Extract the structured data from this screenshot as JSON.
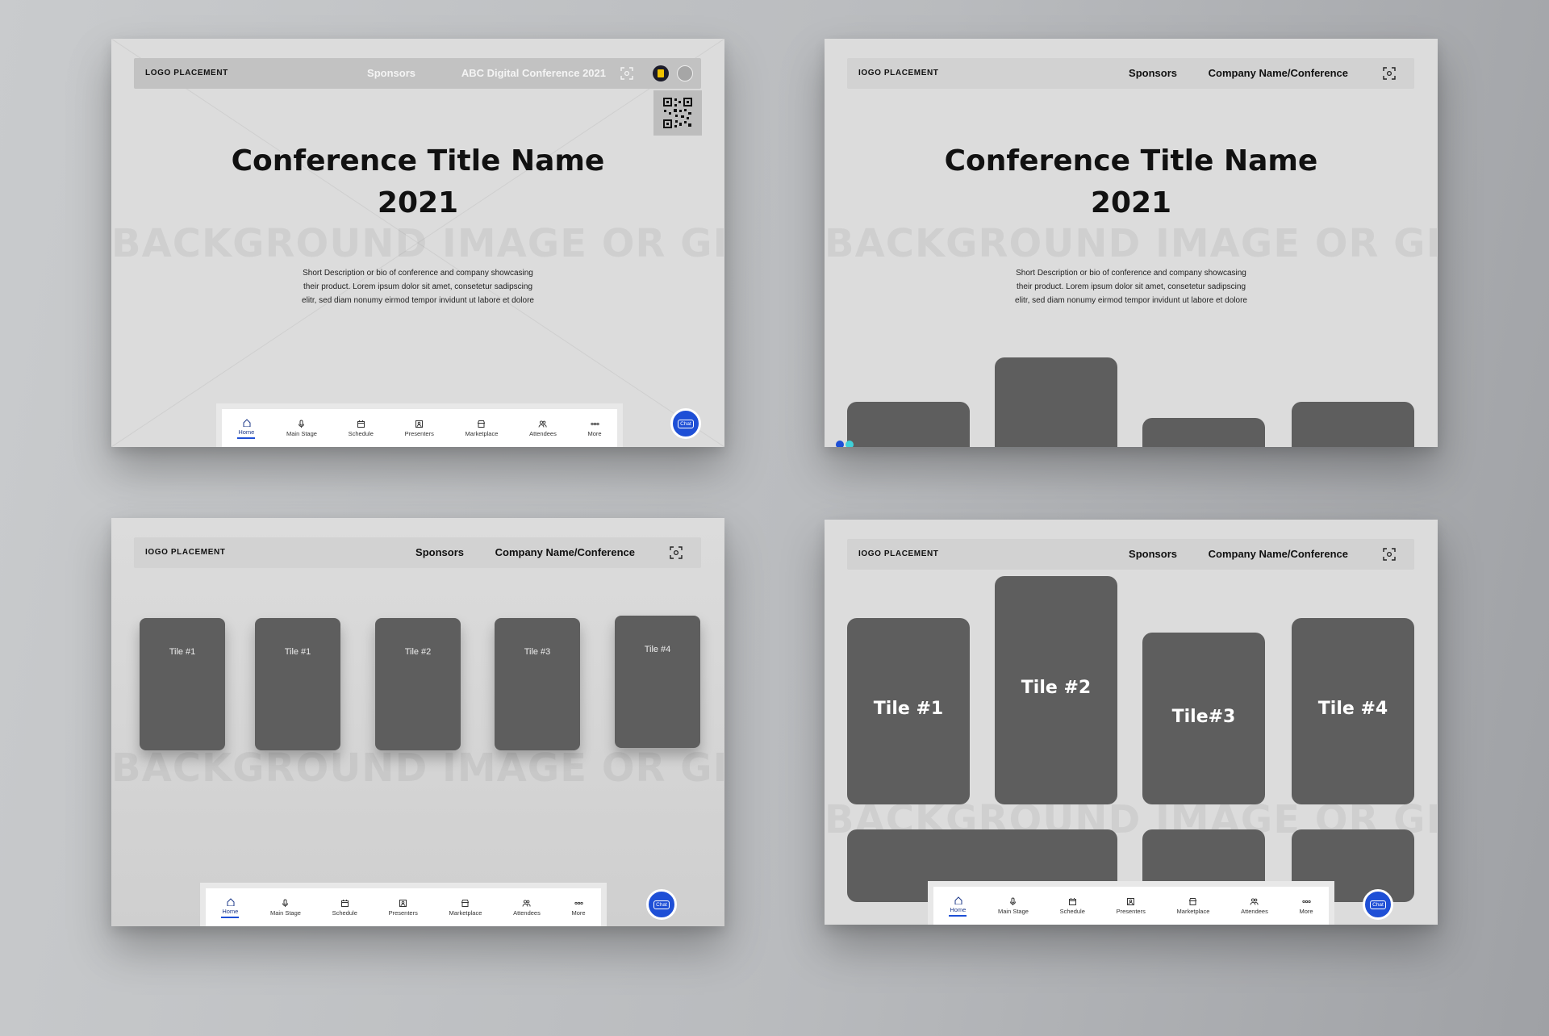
{
  "panels": [
    {
      "header": {
        "logo": "LOGO PLACEMENT",
        "sponsors": "Sponsors",
        "company": "ABC Digital Conference 2021"
      },
      "hero": {
        "title_line1": "Conference Title Name",
        "title_line2": "2021",
        "bg_label": "BACKGROUND IMAGE OR GIF",
        "desc_line1": "Short Description or bio of conference and company showcasing",
        "desc_line2": "their product. Lorem ipsum dolor sit amet, consetetur sadipscing",
        "desc_line3": "elitr, sed diam nonumy eirmod tempor invidunt ut labore et dolore"
      }
    },
    {
      "header": {
        "logo": "IOGO PLACEMENT",
        "sponsors": "Sponsors",
        "company": "Company Name/Conference"
      },
      "hero": {
        "title_line1": "Conference Title Name",
        "title_line2": "2021",
        "bg_label": "BACKGROUND IMAGE OR GIF",
        "desc_line1": "Short Description or bio of conference and company showcasing",
        "desc_line2": "their product. Lorem ipsum dolor sit amet, consetetur sadipscing",
        "desc_line3": "elitr, sed diam nonumy eirmod tempor invidunt ut labore et dolore"
      }
    },
    {
      "header": {
        "logo": "IOGO PLACEMENT",
        "sponsors": "Sponsors",
        "company": "Company Name/Conference"
      },
      "bg_label": "BACKGROUND IMAGE OR GIF",
      "tiles": [
        "Tile #1",
        "Tile #1",
        "Tile #2",
        "Tile #3",
        "Tile #4"
      ]
    },
    {
      "header": {
        "logo": "IOGO PLACEMENT",
        "sponsors": "Sponsors",
        "company": "Company Name/Conference"
      },
      "bg_label": "BACKGROUND IMAGE OR GIF",
      "tiles": [
        "Tile #1",
        "Tile #2",
        "Tile#3",
        "Tile #4"
      ]
    }
  ],
  "bottom_nav": {
    "items": [
      "Home",
      "Main Stage",
      "Schedule",
      "Presenters",
      "Marketplace",
      "Attendees",
      "More"
    ],
    "active": "Home"
  },
  "chat": {
    "label": "Chat"
  },
  "icons": {
    "scan": "scan-icon",
    "qr": "qr-code-icon",
    "chat": "chat-bubble-icon",
    "user": "user-avatar-icon"
  },
  "colors": {
    "accent": "#1e4fd6",
    "tile": "#5e5e5e",
    "panel": "#dcdcdc"
  }
}
